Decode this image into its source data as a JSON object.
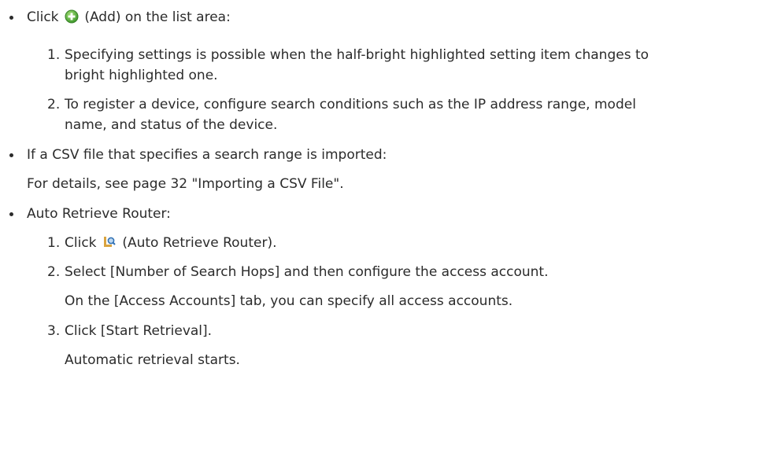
{
  "items": [
    {
      "lead_text": "Click",
      "icon": "add-icon",
      "tail_text": "(Add) on the list area:",
      "steps": [
        {
          "number": "1.",
          "line1": "Specifying settings is possible when the half-bright highlighted setting item changes to",
          "line2": "bright highlighted one."
        },
        {
          "number": "2.",
          "line1": "To register a device, configure search conditions such as the IP address range, model",
          "line2": "name, and status of the device."
        }
      ]
    },
    {
      "text": "If a CSV file that specifies a search range is imported:",
      "note": "For details, see page 32 \"Importing a CSV File\"."
    },
    {
      "text": "Auto Retrieve Router:",
      "steps": [
        {
          "number": "1.",
          "lead_text": "Click",
          "icon": "auto-retrieve-router-icon",
          "tail_text": "(Auto Retrieve Router)."
        },
        {
          "number": "2.",
          "text": "Select [Number of Search Hops] and then configure the access account.",
          "note": "On the [Access Accounts] tab, you can specify all access accounts."
        },
        {
          "number": "3.",
          "text": "Click [Start Retrieval].",
          "note": "Automatic retrieval starts."
        }
      ]
    }
  ],
  "colors": {
    "text": "#2b2b2b",
    "add_icon": "#5cb85c"
  }
}
